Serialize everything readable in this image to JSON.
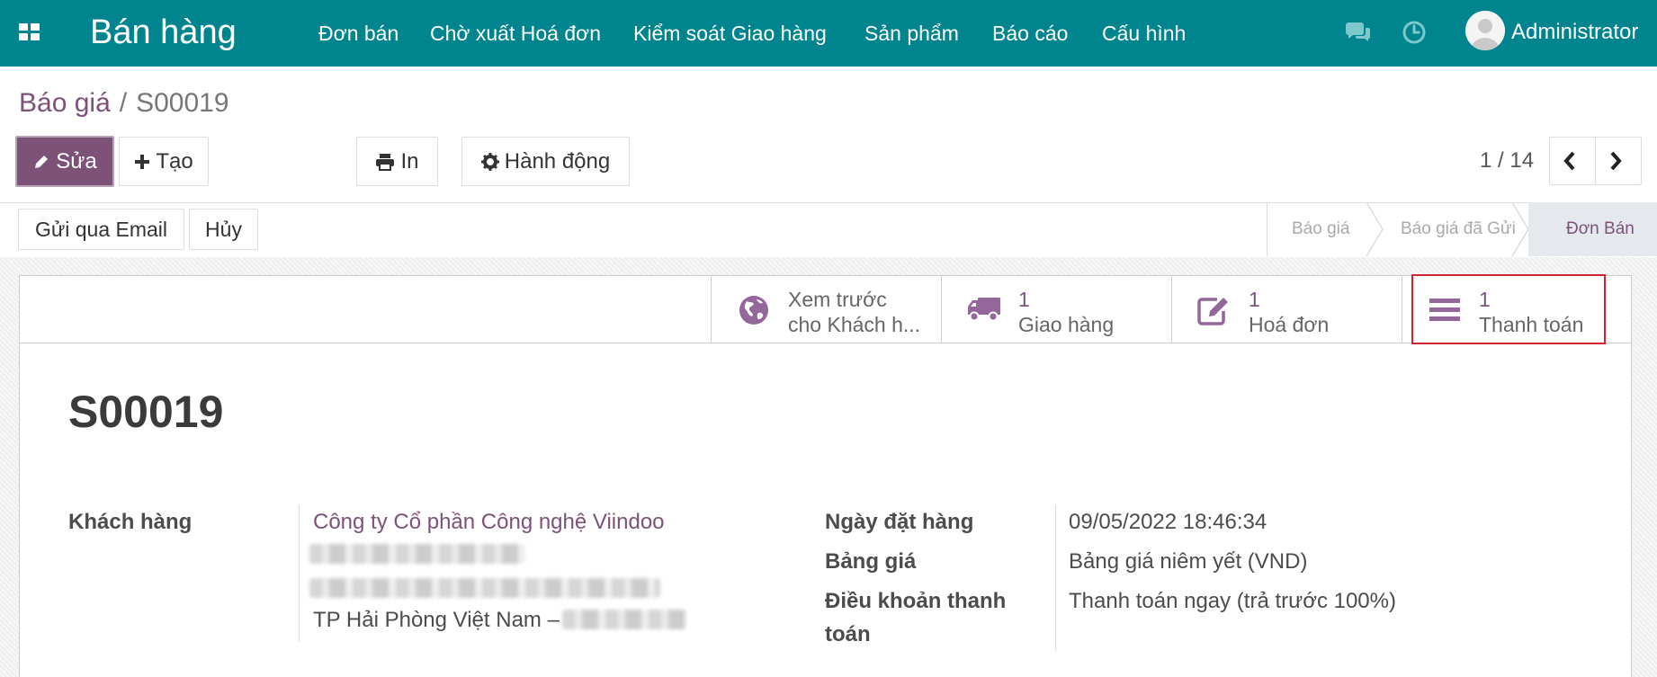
{
  "navbar": {
    "app_title": "Bán hàng",
    "menu": [
      {
        "label": "Đơn bán"
      },
      {
        "label": "Chờ xuất Hoá đơn"
      },
      {
        "label": "Kiểm soát Giao hàng"
      },
      {
        "label": "Sản phẩm"
      },
      {
        "label": "Báo cáo"
      },
      {
        "label": "Cấu hình"
      }
    ],
    "user_name": "Administrator",
    "icons": [
      "apps-icon",
      "chat-icon",
      "clock-icon",
      "avatar"
    ]
  },
  "breadcrumb": {
    "parent": "Báo giá",
    "separator": "/",
    "current": "S00019"
  },
  "toolbar": {
    "edit_label": "Sửa",
    "create_label": "Tạo",
    "print_label": "In",
    "action_label": "Hành động"
  },
  "pager": {
    "value": "1 / 14"
  },
  "status_buttons": {
    "send_email_label": "Gửi qua Email",
    "cancel_label": "Hủy"
  },
  "statusbar": {
    "stages": [
      {
        "label": "Báo giá",
        "active": false
      },
      {
        "label": "Báo giá đã Gửi",
        "active": false
      },
      {
        "label": "Đơn Bán",
        "active": true
      }
    ]
  },
  "smart_buttons": [
    {
      "line1": "Xem trước",
      "line2": "cho Khách h...",
      "icon": "globe-icon"
    },
    {
      "line1": "1",
      "line2": "Giao hàng",
      "icon": "truck-icon"
    },
    {
      "line1": "1",
      "line2": "Hoá đơn",
      "icon": "edit-icon"
    },
    {
      "line1": "1",
      "line2": "Thanh toán",
      "icon": "list-icon"
    }
  ],
  "record": {
    "name": "S00019",
    "customer_label": "Khách hàng",
    "customer_name": "Công ty Cổ phần Công nghệ Viindoo",
    "customer_city": "TP Hải Phòng Việt Nam –",
    "order_date_label": "Ngày đặt hàng",
    "order_date": "09/05/2022 18:46:34",
    "pricelist_label": "Bảng giá",
    "pricelist": "Bảng giá niêm yết (VND)",
    "payment_terms_label_1": "Điều khoản thanh",
    "payment_terms_label_2": "toán",
    "payment_terms": "Thanh toán ngay (trả trước 100%)"
  },
  "colors": {
    "navbar": "#00858f",
    "primary": "#7c5279",
    "highlight": "#d0252e"
  }
}
